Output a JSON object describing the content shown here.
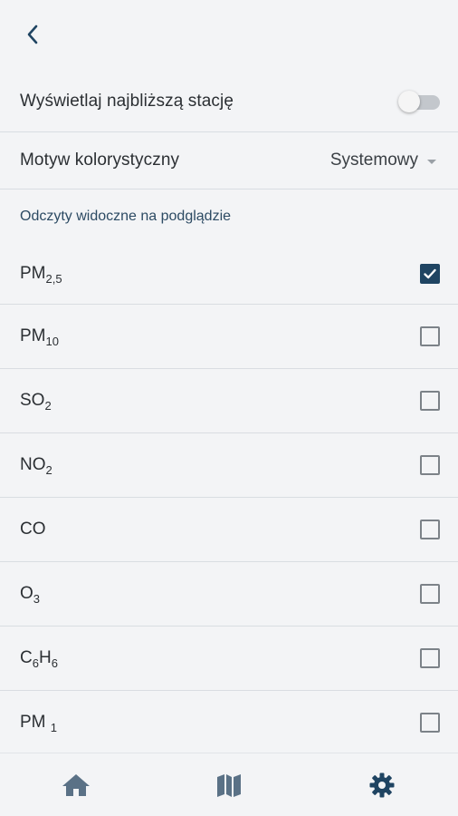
{
  "header": {
    "back_icon": "chevron-left-icon"
  },
  "settings": {
    "nearest_station": {
      "label": "Wyświetlaj najbliższą stację",
      "enabled": false
    },
    "color_theme": {
      "label": "Motyw kolorystyczny",
      "value": "Systemowy"
    }
  },
  "readings_section": {
    "title": "Odczyty widoczne na podglądzie",
    "items": [
      {
        "label": "PM",
        "sub": "2,5",
        "checked": true
      },
      {
        "label": "PM",
        "sub": "10",
        "checked": false
      },
      {
        "label": "SO",
        "sub": "2",
        "checked": false
      },
      {
        "label": "NO",
        "sub": "2",
        "checked": false
      },
      {
        "label": "CO",
        "sub": "",
        "checked": false
      },
      {
        "label": "O",
        "sub": "3",
        "checked": false
      },
      {
        "label": "C",
        "sub": "6",
        "label2": "H",
        "sub2": "6",
        "checked": false
      },
      {
        "label": "PM ",
        "sub": "1",
        "checked": false
      }
    ]
  },
  "bottom_nav": {
    "items": [
      {
        "icon": "home-icon"
      },
      {
        "icon": "map-icon"
      },
      {
        "icon": "gear-icon",
        "active": true
      }
    ]
  },
  "colors": {
    "accent": "#1f4462",
    "icon_muted": "#5a7186",
    "background": "#f3f4f6",
    "divider": "#d9dde2"
  }
}
